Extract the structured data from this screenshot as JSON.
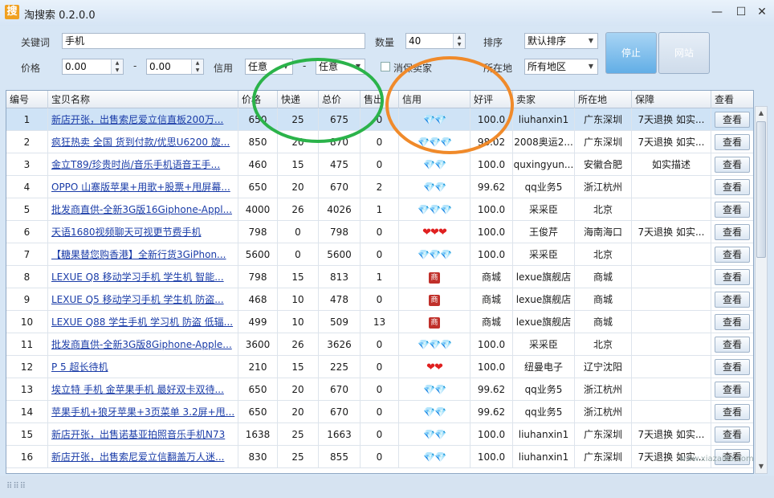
{
  "window": {
    "title": "淘搜索  0.2.0.0",
    "icon_text": "搜",
    "minimize": "—",
    "maximize": "☐",
    "close": "✕"
  },
  "search": {
    "keyword_label": "关键词",
    "keyword_value": "手机",
    "count_label": "数量",
    "count_value": "40",
    "sort_label": "排序",
    "sort_value": "默认排序",
    "price_label": "价格",
    "price_min": "0.00",
    "price_sep": "-",
    "price_max": "0.00",
    "credit_label": "信用",
    "credit_min": "任意",
    "credit_sep": "-",
    "credit_max": "任意",
    "guarantee_label": "消保卖家",
    "location_label": "所在地",
    "location_value": "所有地区",
    "stop_button": "停止",
    "site_button": "网站"
  },
  "table": {
    "columns": [
      "编号",
      "宝贝名称",
      "价格",
      "快递",
      "总价",
      "售出",
      "信用",
      "好评",
      "卖家",
      "所在地",
      "保障",
      "查看"
    ],
    "view_label": "查看",
    "rows": [
      {
        "no": "1",
        "name": "新店开张，出售索尼爱立信直板200万...",
        "price": "650",
        "ship": "25",
        "total": "675",
        "sold": "0",
        "credit": "gem",
        "credit_text": "💎💎",
        "rate": "100.0",
        "seller": "liuhanxin1",
        "loc": "广东深圳",
        "guar": "7天退换 如实..."
      },
      {
        "no": "2",
        "name": "疯狂热卖 全国 货到付款/优思U6200 旋...",
        "price": "850",
        "ship": "20",
        "total": "870",
        "sold": "0",
        "credit": "gem",
        "credit_text": "💎💎💎",
        "rate": "98.02",
        "seller": "2008奥运2...",
        "loc": "广东深圳",
        "guar": "7天退换 如实..."
      },
      {
        "no": "3",
        "name": "金立T89/珍贵时尚/音乐手机语音王手...",
        "price": "460",
        "ship": "15",
        "total": "475",
        "sold": "0",
        "credit": "gem",
        "credit_text": "💎💎",
        "rate": "100.0",
        "seller": "quxingyun...",
        "loc": "安徽合肥",
        "guar": "如实描述"
      },
      {
        "no": "4",
        "name": "OPPO 山寨版苹果+用歌+股票+甩屏幕...",
        "price": "650",
        "ship": "20",
        "total": "670",
        "sold": "2",
        "credit": "gem",
        "credit_text": "💎💎",
        "rate": "99.62",
        "seller": "qq业务5",
        "loc": "浙江杭州",
        "guar": ""
      },
      {
        "no": "5",
        "name": "批发商直供-全新3G版16Giphone-Appl...",
        "price": "4000",
        "ship": "26",
        "total": "4026",
        "sold": "1",
        "credit": "gem",
        "credit_text": "💎💎💎",
        "rate": "100.0",
        "seller": "采采臣",
        "loc": "北京",
        "guar": ""
      },
      {
        "no": "6",
        "name": "天语1680视频聊天可视更节费手机",
        "price": "798",
        "ship": "0",
        "total": "798",
        "sold": "0",
        "credit": "heart",
        "credit_text": "❤❤❤",
        "rate": "100.0",
        "seller": "王俊芹",
        "loc": "海南海口",
        "guar": "7天退换 如实..."
      },
      {
        "no": "7",
        "name": "【糖果替您购香港】全新行货3GiPhon...",
        "price": "5600",
        "ship": "0",
        "total": "5600",
        "sold": "0",
        "credit": "gem",
        "credit_text": "💎💎💎",
        "rate": "100.0",
        "seller": "采采臣",
        "loc": "北京",
        "guar": ""
      },
      {
        "no": "8",
        "name": "LEXUE Q8 移动学习手机 学生机 智能...",
        "price": "798",
        "ship": "15",
        "total": "813",
        "sold": "1",
        "credit": "mall",
        "credit_text": "商",
        "rate": "商城",
        "seller": "lexue旗舰店",
        "loc": "商城",
        "guar": ""
      },
      {
        "no": "9",
        "name": "LEXUE Q5 移动学习手机 学生机 防盗...",
        "price": "468",
        "ship": "10",
        "total": "478",
        "sold": "0",
        "credit": "mall",
        "credit_text": "商",
        "rate": "商城",
        "seller": "lexue旗舰店",
        "loc": "商城",
        "guar": ""
      },
      {
        "no": "10",
        "name": "LEXUE Q88 学生手机 学习机 防盗 低辐...",
        "price": "499",
        "ship": "10",
        "total": "509",
        "sold": "13",
        "credit": "mall",
        "credit_text": "商",
        "rate": "商城",
        "seller": "lexue旗舰店",
        "loc": "商城",
        "guar": ""
      },
      {
        "no": "11",
        "name": "批发商直供-全新3G版8Giphone-Apple...",
        "price": "3600",
        "ship": "26",
        "total": "3626",
        "sold": "0",
        "credit": "gem",
        "credit_text": "💎💎💎",
        "rate": "100.0",
        "seller": "采采臣",
        "loc": "北京",
        "guar": ""
      },
      {
        "no": "12",
        "name": "P 5 超长待机",
        "price": "210",
        "ship": "15",
        "total": "225",
        "sold": "0",
        "credit": "heart",
        "credit_text": "❤❤",
        "rate": "100.0",
        "seller": "纽曼电子",
        "loc": "辽宁沈阳",
        "guar": ""
      },
      {
        "no": "13",
        "name": "埃立特 手机 金苹果手机 最好双卡双待...",
        "price": "650",
        "ship": "20",
        "total": "670",
        "sold": "0",
        "credit": "gem",
        "credit_text": "💎💎",
        "rate": "99.62",
        "seller": "qq业务5",
        "loc": "浙江杭州",
        "guar": ""
      },
      {
        "no": "14",
        "name": "苹果手机+狼牙苹果+3页菜单 3.2屏+甩...",
        "price": "650",
        "ship": "20",
        "total": "670",
        "sold": "0",
        "credit": "gem",
        "credit_text": "💎💎",
        "rate": "99.62",
        "seller": "qq业务5",
        "loc": "浙江杭州",
        "guar": ""
      },
      {
        "no": "15",
        "name": "新店开张，出售诺基亚拍照音乐手机N73",
        "price": "1638",
        "ship": "25",
        "total": "1663",
        "sold": "0",
        "credit": "gem",
        "credit_text": "💎💎",
        "rate": "100.0",
        "seller": "liuhanxin1",
        "loc": "广东深圳",
        "guar": "7天退换 如实..."
      },
      {
        "no": "16",
        "name": "新店开张，出售索尼爱立信翻盖万人迷...",
        "price": "830",
        "ship": "25",
        "total": "855",
        "sold": "0",
        "credit": "gem",
        "credit_text": "💎💎",
        "rate": "100.0",
        "seller": "liuhanxin1",
        "loc": "广东深圳",
        "guar": "7天退换 如实..."
      }
    ]
  },
  "status": {
    "grip": "⠿⠿⠿"
  },
  "watermark": "www.xiazaiba.com",
  "colors": {
    "selected_row": "#cfe3f6",
    "link": "#1a3ca8",
    "green_ring": "#2bb34a",
    "orange_ring": "#f08a2a"
  }
}
